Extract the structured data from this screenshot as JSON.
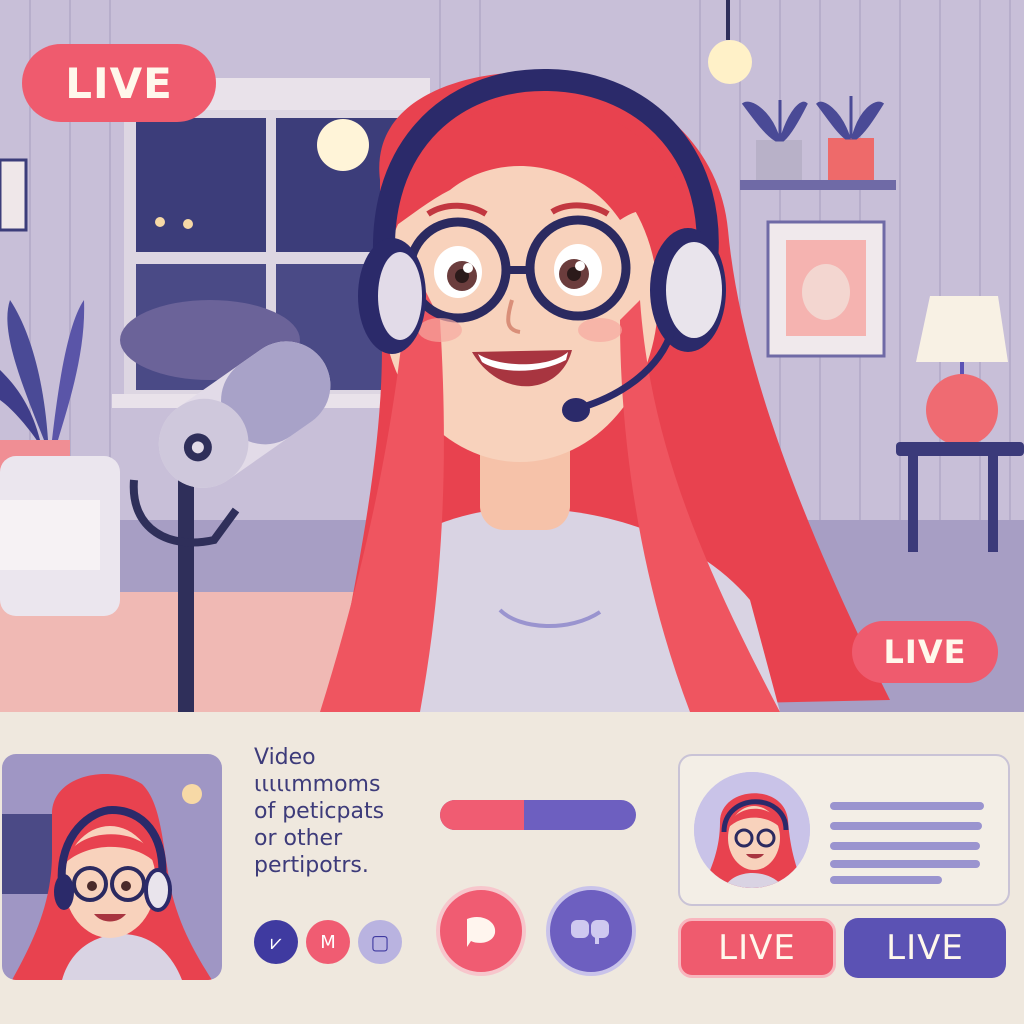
{
  "stream": {
    "live_badge_main": "LIVE",
    "live_badge_small": "LIVE"
  },
  "caption": {
    "line1": "Video",
    "line2": "ιιιιιmmoms",
    "line3": "of peticpats",
    "line4": "or other",
    "line5": "pertipotrs."
  },
  "progress": {
    "value": 0.43
  },
  "controls": {
    "small": [
      {
        "icon": "chevron-check-icon",
        "glyph": "⩗",
        "color": "#3f3aa0"
      },
      {
        "icon": "m-icon",
        "glyph": "M",
        "color": "#f05c72"
      },
      {
        "icon": "square-icon",
        "glyph": "▢",
        "color": "#8e87c9"
      }
    ],
    "big_red_icon": "speech-bubble-icon",
    "big_purple_icon": "chat-icon"
  },
  "participant_card": {
    "lines": 5
  },
  "buttons": {
    "live_red": "LIVE",
    "live_purple": "LIVE"
  },
  "colors": {
    "accent_red": "#ef5b6e",
    "accent_purple": "#5b52b4",
    "background": "#efe8de",
    "hair": "#e8424f"
  }
}
